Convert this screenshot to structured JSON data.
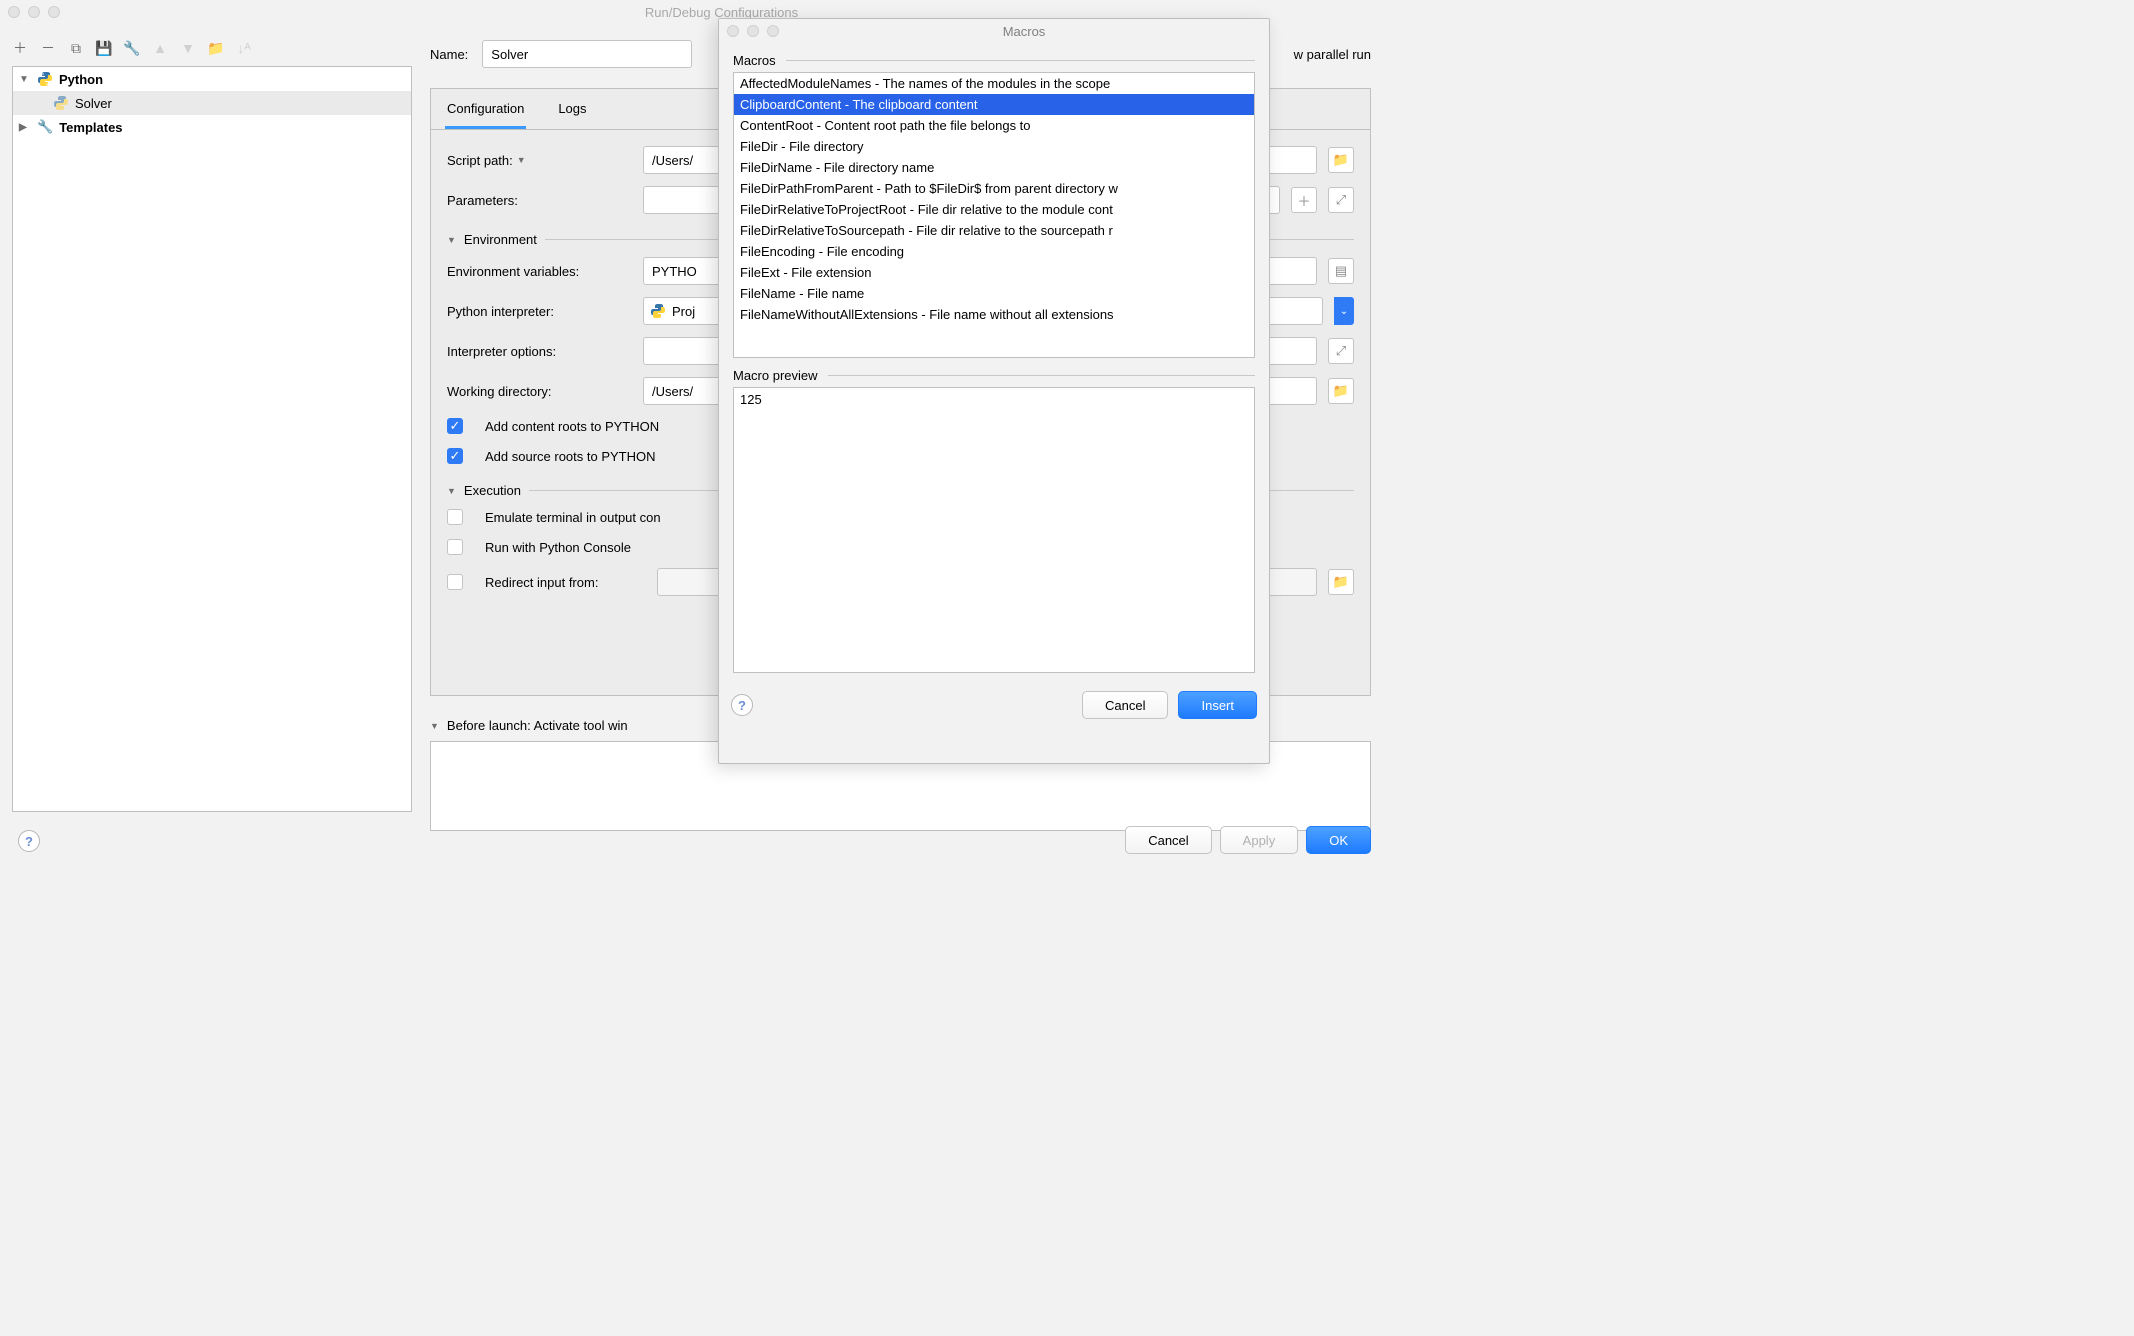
{
  "window": {
    "title": "Run/Debug Configurations"
  },
  "tree": {
    "python": "Python",
    "solver": "Solver",
    "templates": "Templates"
  },
  "form": {
    "name_label": "Name:",
    "name_value": "Solver",
    "allow_parallel": "w parallel run",
    "tabs": {
      "config": "Configuration",
      "logs": "Logs"
    },
    "script_label": "Script path:",
    "script_value": "/Users/",
    "params_label": "Parameters:",
    "env_header": "Environment",
    "envvars_label": "Environment variables:",
    "envvars_value": "PYTHO",
    "interp_label": "Python interpreter:",
    "interp_value": "Proj",
    "interp_opts_label": "Interpreter options:",
    "workdir_label": "Working directory:",
    "workdir_value": "/Users/",
    "add_content": "Add content roots to PYTHON",
    "add_source": "Add source roots to PYTHON",
    "exec_header": "Execution",
    "emulate": "Emulate terminal in output con",
    "run_console": "Run with Python Console",
    "redirect": "Redirect input from:",
    "before": "Before launch: Activate tool win"
  },
  "buttons": {
    "cancel": "Cancel",
    "apply": "Apply",
    "ok": "OK",
    "insert": "Insert"
  },
  "macros": {
    "title": "Macros",
    "group": "Macros",
    "items": [
      "AffectedModuleNames - The names of the modules in the scope",
      "ClipboardContent - The clipboard content",
      "ContentRoot - Content root path the file belongs to",
      "FileDir - File directory",
      "FileDirName - File directory name",
      "FileDirPathFromParent - Path to $FileDir$ from parent directory w",
      "FileDirRelativeToProjectRoot - File dir relative to the module cont",
      "FileDirRelativeToSourcepath - File dir relative to the sourcepath r",
      "FileEncoding - File encoding",
      "FileExt - File extension",
      "FileName - File name",
      "FileNameWithoutAllExtensions - File name without all extensions"
    ],
    "selected_index": 1,
    "preview_label": "Macro preview",
    "preview_value": "125"
  }
}
